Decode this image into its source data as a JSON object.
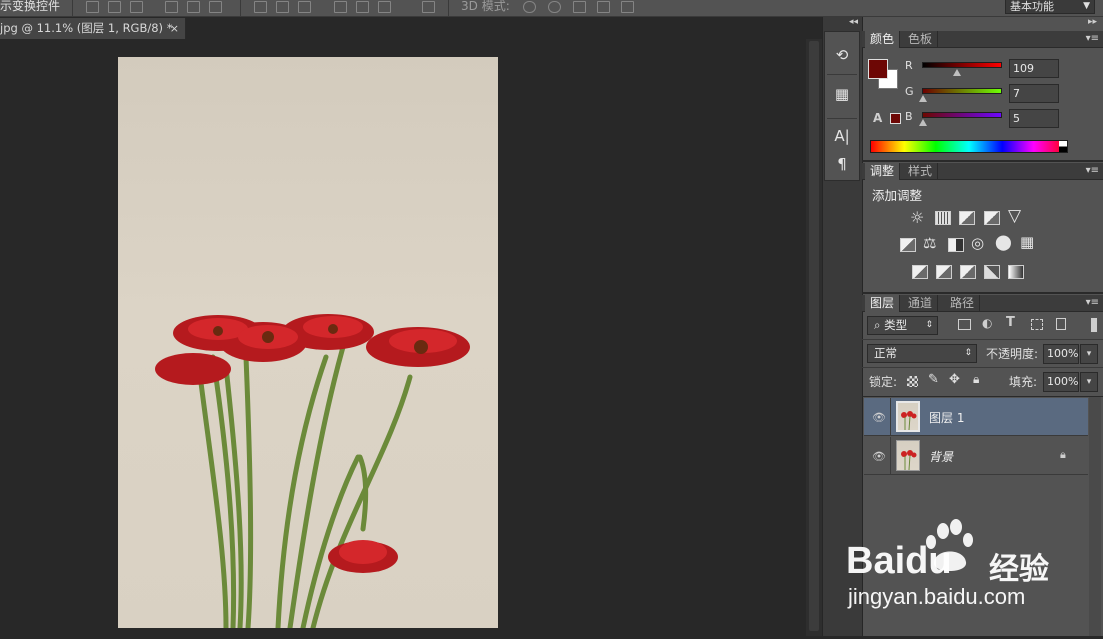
{
  "options_bar": {
    "transform_label": "示变换控件",
    "mode_3d_label": "3D 模式:",
    "workspace": "基本功能"
  },
  "document": {
    "tab_title": "jpg @ 11.1% (图层 1, RGB/8) *",
    "close": "×"
  },
  "dock": {
    "collapse": "◂◂",
    "right_collapse": "▸▸"
  },
  "color_panel": {
    "tabs": [
      "颜色",
      "色板"
    ],
    "r_label": "R",
    "g_label": "G",
    "b_label": "B",
    "r": "109",
    "g": "7",
    "b": "5",
    "foreground": "#6d0705",
    "background": "#ffffff"
  },
  "adjust_panel": {
    "tabs": [
      "调整",
      "样式"
    ],
    "title": "添加调整"
  },
  "layers_panel": {
    "tabs": [
      "图层",
      "通道",
      "路径"
    ],
    "filter_kind": "类型",
    "blend_mode": "正常",
    "opacity_label": "不透明度:",
    "opacity": "100%",
    "lock_label": "锁定:",
    "fill_label": "填充:",
    "fill": "100%",
    "layers": [
      {
        "name": "图层 1",
        "selected": true
      },
      {
        "name": "背景",
        "locked": true
      }
    ]
  },
  "watermark": {
    "brand": "Baidu",
    "suffix": "经验",
    "url": "jingyan.baidu.com"
  }
}
